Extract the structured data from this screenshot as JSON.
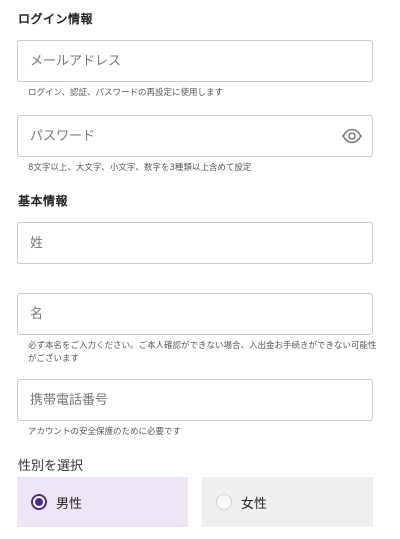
{
  "login_section": {
    "title": "ログイン情報",
    "email": {
      "placeholder": "メールアドレス",
      "value": "",
      "helper": "ログイン、認証、パスワードの再設定に使用します"
    },
    "password": {
      "placeholder": "パスワード",
      "value": "",
      "helper": "8文字以上、大文字、小文字、数字を3種類以上含めて設定",
      "toggle_icon": "eye-icon"
    }
  },
  "basic_section": {
    "title": "基本情報",
    "last_name": {
      "placeholder": "姓",
      "value": ""
    },
    "first_name": {
      "placeholder": "名",
      "value": "",
      "helper": "必ず本名をご入力ください。ご本人確認ができない場合、入出金お手続きができない可能性がございます"
    },
    "phone": {
      "placeholder": "携帯電話番号",
      "value": "",
      "helper": "アカウントの安全保護のために必要です"
    }
  },
  "gender": {
    "label": "性別を選択",
    "options": [
      {
        "label": "男性",
        "selected": true
      },
      {
        "label": "女性",
        "selected": false
      }
    ]
  },
  "colors": {
    "accent": "#4b2b8f",
    "selected_bg": "#ede5f5",
    "unselected_bg": "#efefef",
    "border": "#c9c9c9"
  }
}
